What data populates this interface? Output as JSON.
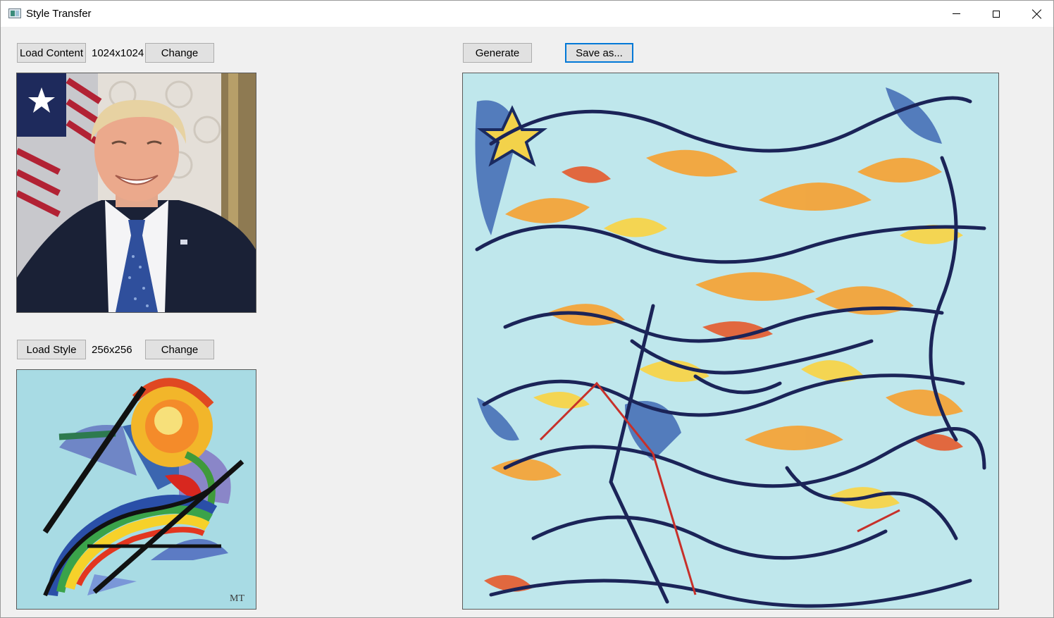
{
  "window": {
    "title": "Style Transfer",
    "icon": "app-window-icon",
    "controls": [
      "minimize-icon",
      "maximize-icon",
      "close-icon"
    ]
  },
  "content": {
    "load_label": "Load Content",
    "size": "1024x1024",
    "change_label": "Change",
    "image": "portrait-photo"
  },
  "style": {
    "load_label": "Load Style",
    "size": "256x256",
    "change_label": "Change",
    "image": "abstract-painting",
    "signature": "MT"
  },
  "output": {
    "generate_label": "Generate",
    "save_label": "Save as...",
    "image": "stylized-output"
  },
  "colors": {
    "window_bg": "#f0f0f0",
    "button_bg": "#e1e1e1",
    "focus_border": "#0078d7"
  }
}
